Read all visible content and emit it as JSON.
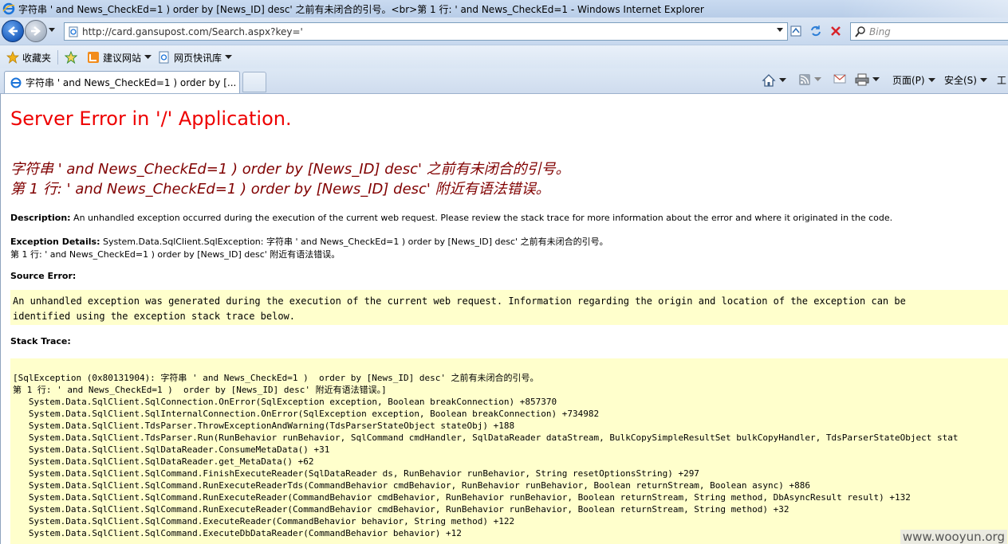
{
  "window": {
    "title": "字符串 ' and News_CheckEd=1 ) order by [News_ID] desc' 之前有未闭合的引号。<br>第 1 行: ' and News_CheckEd=1  - Windows Internet Explorer"
  },
  "address_bar": {
    "url": "http://card.gansupost.com/Search.aspx?key='",
    "search_placeholder": "Bing"
  },
  "favorites_bar": {
    "favorites_label": "收藏夹",
    "suggested_sites_label": "建议网站",
    "web_slice_label": "网页快讯库"
  },
  "tabs": [
    {
      "label": "字符串 ' and News_CheckEd=1 ) order by [..."
    }
  ],
  "command_bar": {
    "page_label": "页面(P)",
    "safety_label": "安全(S)",
    "tools_label": "工"
  },
  "page": {
    "heading": "Server Error in '/' Application.",
    "error_line1": "字符串 ' and News_CheckEd=1 ) order by [News_ID] desc' 之前有未闭合的引号。",
    "error_line2": "第 1 行: ' and News_CheckEd=1 ) order by [News_ID] desc' 附近有语法错误。",
    "description_label": "Description:",
    "description_text": " An unhandled exception occurred during the execution of the current web request. Please review the stack trace for more information about the error and where it originated in the code.",
    "exception_label": "Exception Details:",
    "exception_text": " System.Data.SqlClient.SqlException: 字符串 ' and News_CheckEd=1 ) order by [News_ID] desc' 之前有未闭合的引号。",
    "exception_text2": "第 1 行: ' and News_CheckEd=1 ) order by [News_ID] desc' 附近有语法错误。",
    "source_error_label": "Source Error:",
    "source_error_text": "An unhandled exception was generated during the execution of the current web request. Information regarding the origin and location of the exception can be\nidentified using the exception stack trace below.",
    "stack_trace_label": "Stack Trace:",
    "stack_trace_text": "[SqlException (0x80131904): 字符串 ' and News_CheckEd=1 )  order by [News_ID] desc' 之前有未闭合的引号。\n第 1 行: ' and News_CheckEd=1 )  order by [News_ID] desc' 附近有语法错误。]\n   System.Data.SqlClient.SqlConnection.OnError(SqlException exception, Boolean breakConnection) +857370\n   System.Data.SqlClient.SqlInternalConnection.OnError(SqlException exception, Boolean breakConnection) +734982\n   System.Data.SqlClient.TdsParser.ThrowExceptionAndWarning(TdsParserStateObject stateObj) +188\n   System.Data.SqlClient.TdsParser.Run(RunBehavior runBehavior, SqlCommand cmdHandler, SqlDataReader dataStream, BulkCopySimpleResultSet bulkCopyHandler, TdsParserStateObject stat\n   System.Data.SqlClient.SqlDataReader.ConsumeMetaData() +31\n   System.Data.SqlClient.SqlDataReader.get_MetaData() +62\n   System.Data.SqlClient.SqlCommand.FinishExecuteReader(SqlDataReader ds, RunBehavior runBehavior, String resetOptionsString) +297\n   System.Data.SqlClient.SqlCommand.RunExecuteReaderTds(CommandBehavior cmdBehavior, RunBehavior runBehavior, Boolean returnStream, Boolean async) +886\n   System.Data.SqlClient.SqlCommand.RunExecuteReader(CommandBehavior cmdBehavior, RunBehavior runBehavior, Boolean returnStream, String method, DbAsyncResult result) +132\n   System.Data.SqlClient.SqlCommand.RunExecuteReader(CommandBehavior cmdBehavior, RunBehavior runBehavior, Boolean returnStream, String method) +32\n   System.Data.SqlClient.SqlCommand.ExecuteReader(CommandBehavior behavior, String method) +122\n   System.Data.SqlClient.SqlCommand.ExecuteDbDataReader(CommandBehavior behavior) +12"
  },
  "watermark": "www.wooyun.org",
  "colors": {
    "error_heading": "#ee0000",
    "error_message": "#800000",
    "code_background": "#ffffcc"
  }
}
